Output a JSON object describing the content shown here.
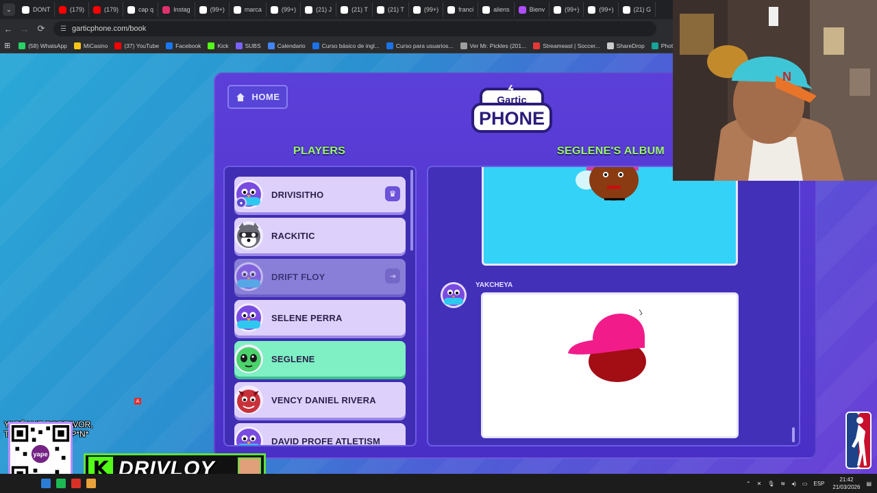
{
  "browser": {
    "tabs": [
      {
        "label": "DONT",
        "color": "#ffffff"
      },
      {
        "label": "(179)",
        "color": "#ff0000"
      },
      {
        "label": "(179)",
        "color": "#ff0000"
      },
      {
        "label": "cap q",
        "color": "#ffffff"
      },
      {
        "label": "Instag",
        "color": "#e1306c"
      },
      {
        "label": "(99+)",
        "color": "#ffffff"
      },
      {
        "label": "marca",
        "color": "#ffffff"
      },
      {
        "label": "(99+)",
        "color": "#ffffff"
      },
      {
        "label": "(21) J",
        "color": "#ffffff"
      },
      {
        "label": "(21) T",
        "color": "#ffffff"
      },
      {
        "label": "(21) T",
        "color": "#ffffff"
      },
      {
        "label": "(99+)",
        "color": "#ffffff"
      },
      {
        "label": "franci",
        "color": "#ffffff"
      },
      {
        "label": "aliens",
        "color": "#ffffff"
      },
      {
        "label": "Bienv",
        "color": "#b04dff"
      },
      {
        "label": "(99+)",
        "color": "#ffffff"
      },
      {
        "label": "(99+)",
        "color": "#ffffff"
      },
      {
        "label": "(21) G",
        "color": "#ffffff"
      }
    ],
    "url": "garticphone.com/book",
    "bookmarks": [
      {
        "label": "(58) WhatsApp",
        "color": "#25d366"
      },
      {
        "label": "MiCasino",
        "color": "#f5c518"
      },
      {
        "label": "(37) YouTube",
        "color": "#ff0000"
      },
      {
        "label": "Facebook",
        "color": "#1877f2"
      },
      {
        "label": "Kick",
        "color": "#53fc18"
      },
      {
        "label": "SUBS",
        "color": "#7b61ff"
      },
      {
        "label": "Calendario",
        "color": "#4285f4"
      },
      {
        "label": "Curso básico de ingl...",
        "color": "#1a73e8"
      },
      {
        "label": "Curso para usuarios...",
        "color": "#1a73e8"
      },
      {
        "label": "Ver Mr. Pickles (201...",
        "color": "#9e9e9e"
      },
      {
        "label": "Streameast | Soccer...",
        "color": "#e53935"
      },
      {
        "label": "ShareDrop",
        "color": "#cccccc"
      },
      {
        "label": "Photopea",
        "color": "#18a497"
      }
    ]
  },
  "game": {
    "home_label": "HOME",
    "logo_top": "Gartic",
    "logo_bottom": "PHONE",
    "players_heading": "PLAYERS",
    "album_heading": "SEGLENE'S ALBUM",
    "players": [
      {
        "name": "DRIVISITHO",
        "state": "host",
        "avatar": "purple-bird"
      },
      {
        "name": "RACKITIC",
        "state": "normal",
        "avatar": "raccoon"
      },
      {
        "name": "DRIFT FLOY",
        "state": "left",
        "avatar": "purple-bird"
      },
      {
        "name": "SELENE PERRA",
        "state": "normal",
        "avatar": "purple-bird"
      },
      {
        "name": "SEGLENE",
        "state": "active",
        "avatar": "green-alien"
      },
      {
        "name": "VENCY DANIEL RIVERA",
        "state": "normal",
        "avatar": "red-devil"
      },
      {
        "name": "DAVID PROFE ATLETISM",
        "state": "normal",
        "avatar": "purple-bird"
      }
    ],
    "album_author": "YAKCHEYA"
  },
  "overlay": {
    "donation_line1": "YAPÉAME PORFAVOR,",
    "donation_line2": "TE CHUPARÉ  EL P*N*",
    "qr_label": "yape",
    "kick_name": "DRIVLOY",
    "kick_letter": "K",
    "small_badge": "A"
  },
  "taskbar": {
    "language": "ESP",
    "time": "21:42",
    "date": "21/03/2026"
  },
  "colors": {
    "accent_green": "#9bf56b",
    "panel_purple": "#4a2fc6",
    "active_player": "#7ff0c3"
  }
}
